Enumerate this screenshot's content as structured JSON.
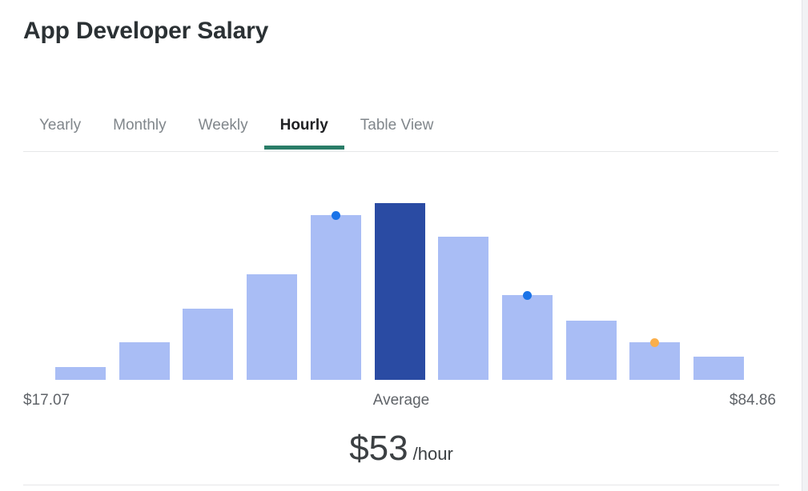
{
  "header": {
    "title": "App Developer Salary"
  },
  "tabs": {
    "items": [
      {
        "label": "Yearly",
        "active": false
      },
      {
        "label": "Monthly",
        "active": false
      },
      {
        "label": "Weekly",
        "active": false
      },
      {
        "label": "Hourly",
        "active": true
      },
      {
        "label": "Table View",
        "active": false
      }
    ],
    "active_underline_color": "#2a7d68"
  },
  "axis": {
    "min_label": "$17.07",
    "center_label": "Average",
    "max_label": "$84.86"
  },
  "summary": {
    "amount": "$53",
    "unit": "/hour"
  },
  "colors": {
    "bar": "#a9bdf5",
    "bar_highlight": "#2a4ba3",
    "marker_blue": "#1a73e8",
    "marker_orange": "#fbaf4b",
    "accent": "#2a7d68",
    "title_text": "#2b3134",
    "muted_text": "#80868b"
  },
  "chart_data": {
    "type": "bar",
    "title": "App Developer Salary",
    "xlabel": "",
    "ylabel": "",
    "grid": false,
    "legend": "none",
    "orientation": "vertical",
    "description": "Salary distribution histogram from $17.07 to $84.86 per hour, average $53/hour",
    "x_axis_min": 17.07,
    "x_axis_max": 84.86,
    "categories": [
      "1",
      "2",
      "3",
      "4",
      "5",
      "6",
      "7",
      "8",
      "9",
      "10",
      "11"
    ],
    "values": [
      17,
      48,
      92,
      136,
      212,
      228,
      184,
      109,
      76,
      48,
      30
    ],
    "ylim": [
      0,
      235
    ],
    "highlight_index": 5,
    "bars": [
      {
        "index": 0,
        "value": 17,
        "highlighted": false,
        "marker": null
      },
      {
        "index": 1,
        "value": 48,
        "highlighted": false,
        "marker": null
      },
      {
        "index": 2,
        "value": 92,
        "highlighted": false,
        "marker": null
      },
      {
        "index": 3,
        "value": 136,
        "highlighted": false,
        "marker": null
      },
      {
        "index": 4,
        "value": 212,
        "highlighted": false,
        "marker": "blue"
      },
      {
        "index": 5,
        "value": 228,
        "highlighted": true,
        "marker": null
      },
      {
        "index": 6,
        "value": 184,
        "highlighted": false,
        "marker": null
      },
      {
        "index": 7,
        "value": 109,
        "highlighted": false,
        "marker": "blue"
      },
      {
        "index": 8,
        "value": 76,
        "highlighted": false,
        "marker": null
      },
      {
        "index": 9,
        "value": 48,
        "highlighted": false,
        "marker": "orange"
      },
      {
        "index": 10,
        "value": 30,
        "highlighted": false,
        "marker": null
      }
    ]
  }
}
